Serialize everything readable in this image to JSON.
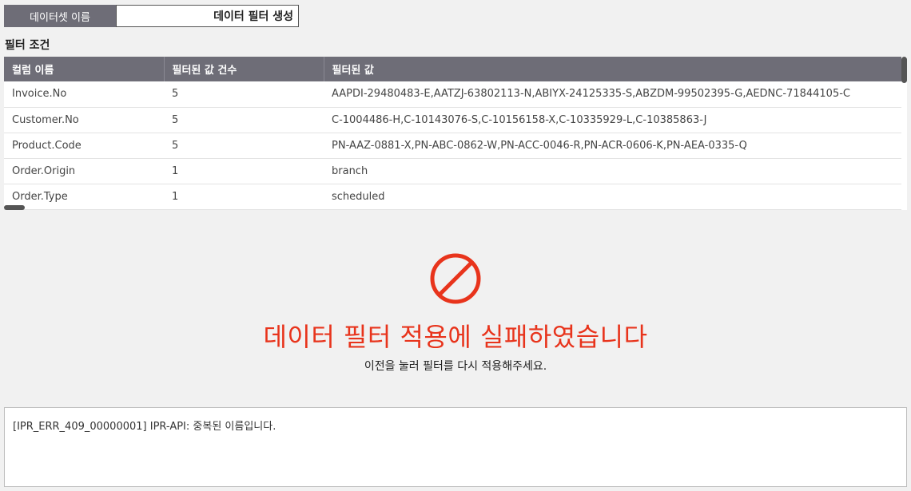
{
  "dataset": {
    "label": "데이터셋 이름",
    "value": "데이터 필터 생성"
  },
  "filter_section": {
    "title": "필터 조건",
    "columns": [
      "컬럼 이름",
      "필터된 값 건수",
      "필터된 값"
    ],
    "rows": [
      [
        "Invoice.No",
        "5",
        "AAPDI-29480483-E,AATZJ-63802113-N,ABIYX-24125335-S,ABZDM-99502395-G,AEDNC-71844105-C"
      ],
      [
        "Customer.No",
        "5",
        "C-1004486-H,C-10143076-S,C-10156158-X,C-10335929-L,C-10385863-J"
      ],
      [
        "Product.Code",
        "5",
        "PN-AAZ-0881-X,PN-ABC-0862-W,PN-ACC-0046-R,PN-ACR-0606-K,PN-AEA-0335-Q"
      ],
      [
        "Order.Origin",
        "1",
        "branch"
      ],
      [
        "Order.Type",
        "1",
        "scheduled"
      ]
    ]
  },
  "error": {
    "icon": "prohibited-icon",
    "color": "#e8341c",
    "title": "데이터 필터 적용에 실패하였습니다",
    "subtitle": "이전을 눌러 필터를 다시 적용해주세요."
  },
  "log": {
    "message": "[IPR_ERR_409_00000001] IPR-API: 중복된 이름입니다."
  },
  "colors": {
    "header_bg": "#6e6d77",
    "error_red": "#e8341c"
  }
}
